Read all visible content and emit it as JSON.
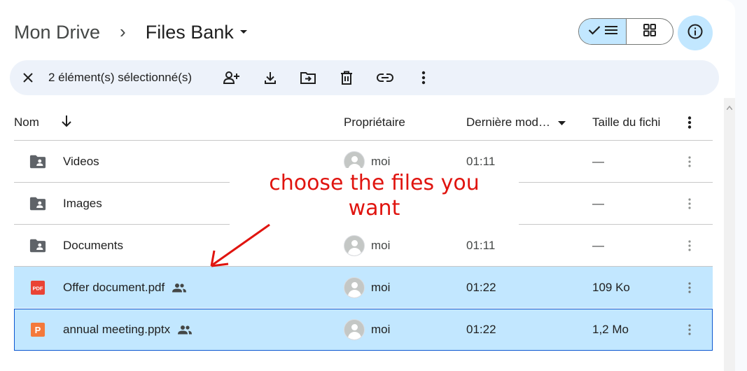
{
  "breadcrumb": {
    "root": "Mon Drive",
    "separator": "›",
    "current": "Files Bank"
  },
  "selection_bar": {
    "count_label": "2 élément(s) sélectionné(s)"
  },
  "columns": {
    "name": "Nom",
    "owner": "Propriétaire",
    "modified": "Dernière mod…",
    "size": "Taille du fichi"
  },
  "rows": [
    {
      "name": "Videos",
      "type": "folder",
      "owner": "moi",
      "modified": "01:11",
      "size": "—",
      "selected": false,
      "shared": false
    },
    {
      "name": "Images",
      "type": "folder",
      "owner": "",
      "modified": "",
      "size": "—",
      "selected": false,
      "shared": false
    },
    {
      "name": "Documents",
      "type": "folder",
      "owner": "moi",
      "modified": "01:11",
      "size": "—",
      "selected": false,
      "shared": false
    },
    {
      "name": "Offer document.pdf",
      "type": "pdf",
      "icon_text": "PDF",
      "owner": "moi",
      "modified": "01:22",
      "size": "109 Ko",
      "selected": true,
      "shared": true
    },
    {
      "name": "annual meeting.pptx",
      "type": "pptx",
      "icon_text": "P",
      "owner": "moi",
      "modified": "01:22",
      "size": "1,2 Mo",
      "selected": true,
      "shared": true
    }
  ],
  "annotation": {
    "line1": "choose the files you",
    "line2": "want",
    "color": "#e0140f"
  },
  "colors": {
    "selected_row": "#c2e7ff",
    "selection_bar": "#edf2fa",
    "accent": "#0b57d0",
    "pdf_red": "#ea4335",
    "pptx_orange": "#f4793b"
  }
}
